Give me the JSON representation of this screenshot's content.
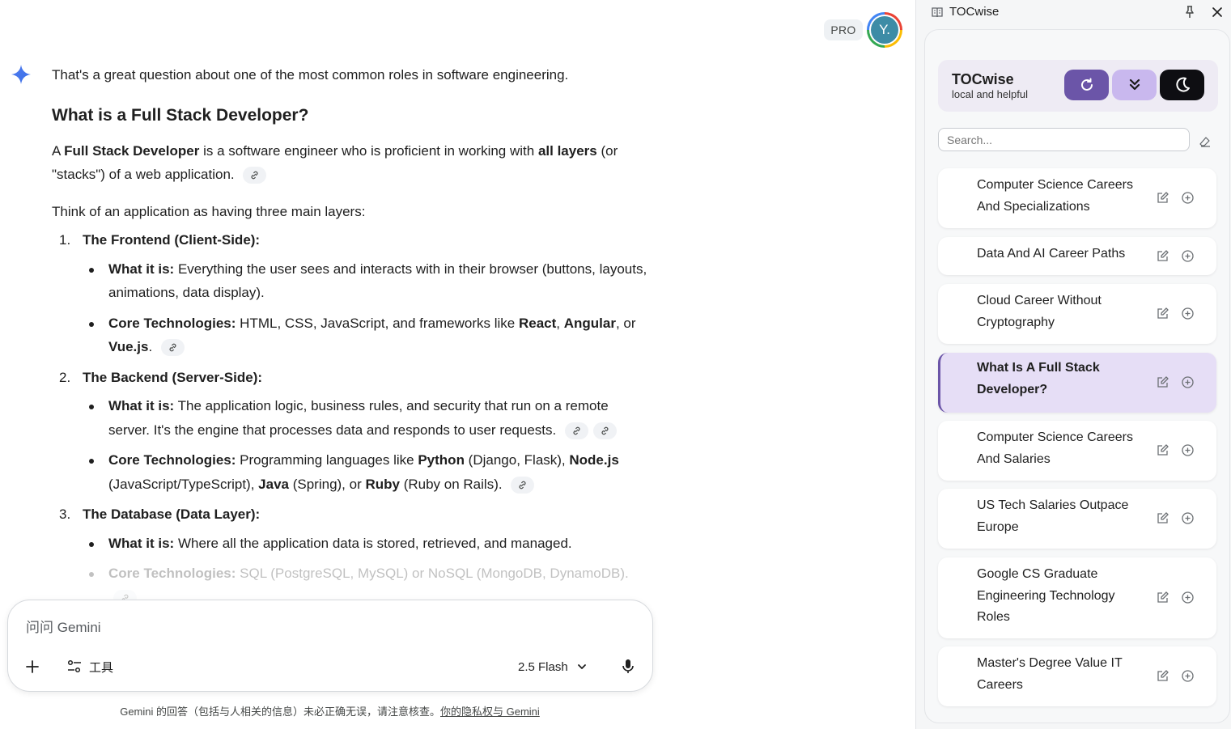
{
  "header": {
    "pro_badge": "PRO",
    "avatar_initial": "Y."
  },
  "response": {
    "intro": "That's a great question about one of the most common roles in software engineering.",
    "heading": "What is a Full Stack Developer?",
    "definition": {
      "prefix": "A ",
      "bold1": "Full Stack Developer",
      "mid": " is a software engineer who is proficient in working with ",
      "bold2": "all layers",
      "suffix": " (or \"stacks\") of a web application."
    },
    "layers_intro": "Think of an application as having three main layers:",
    "layers": [
      {
        "num": "1.",
        "title": "The Frontend (Client-Side):",
        "what_label": "What it is:",
        "what_text": " Everything the user sees and interacts with in their browser (buttons, layouts, animations, data display).",
        "core_label": "Core Technologies:",
        "core_parts": [
          " HTML, CSS, JavaScript, and frameworks like ",
          "React",
          ", ",
          "Angular",
          ", or ",
          "Vue.js",
          "."
        ]
      },
      {
        "num": "2.",
        "title": "The Backend (Server-Side):",
        "what_label": "What it is:",
        "what_text": " The application logic, business rules, and security that run on a remote server. It's the engine that processes data and responds to user requests.",
        "core_label": "Core Technologies:",
        "core_parts": [
          " Programming languages like ",
          "Python",
          " (Django, Flask), ",
          "Node.js",
          " (JavaScript/TypeScript), ",
          "Java",
          " (Spring), or ",
          "Ruby",
          " (Ruby on Rails)."
        ]
      },
      {
        "num": "3.",
        "title": "The Database (Data Layer):",
        "what_label": "What it is:",
        "what_text": " Where all the application data is stored, retrieved, and managed.",
        "core_label": "Core Technologies:",
        "core_text": " SQL (PostgreSQL, MySQL) or NoSQL (MongoDB, DynamoDB)."
      }
    ]
  },
  "composer": {
    "placeholder": "问问 Gemini",
    "tools_label": "工具",
    "model_label": "2.5 Flash"
  },
  "disclaimer": {
    "text": "Gemini 的回答（包括与人相关的信息）未必正确无误，请注意核查。",
    "link": "你的隐私权与 Gemini"
  },
  "panel": {
    "window_title": "TOCwise",
    "brand_name": "TOCwise",
    "brand_tagline": "local and helpful",
    "search_placeholder": "Search...",
    "accent_color": "#6b55a8",
    "toc_items": [
      {
        "label": "Computer Science Careers And Specializations",
        "active": false
      },
      {
        "label": "Data And AI Career Paths",
        "active": false
      },
      {
        "label": "Cloud Career Without Cryptography",
        "active": false
      },
      {
        "label": "What Is A Full Stack Developer?",
        "active": true
      },
      {
        "label": "Computer Science Careers And Salaries",
        "active": false
      },
      {
        "label": "US Tech Salaries Outpace Europe",
        "active": false
      },
      {
        "label": "Google CS Graduate Engineering Technology Roles",
        "active": false
      },
      {
        "label": "Master's Degree Value IT Careers",
        "active": false
      }
    ]
  },
  "icons": {
    "sparkle": "gemini-sparkle-icon",
    "link": "link-icon",
    "plus": "plus-icon",
    "tools": "tools-sliders-icon",
    "chevron": "chevron-down-icon",
    "mic": "microphone-icon",
    "book": "book-icon",
    "pin": "pin-icon",
    "close": "close-icon",
    "refresh": "refresh-icon",
    "expand": "double-chevron-down-icon",
    "theme": "moon-icon",
    "eraser": "eraser-icon",
    "edit": "edit-icon",
    "add": "add-circle-icon"
  }
}
